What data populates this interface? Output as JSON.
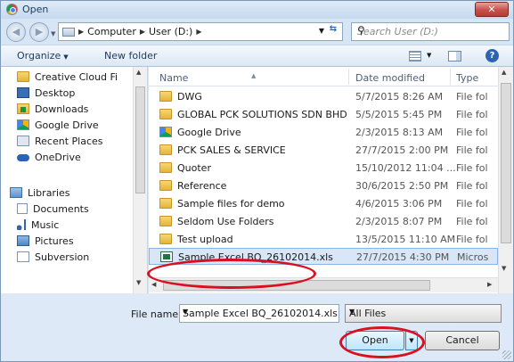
{
  "window": {
    "title": "Open",
    "close_glyph": "✕"
  },
  "nav": {
    "back_glyph": "◀",
    "forward_glyph": "▶",
    "breadcrumbs": [
      "Computer",
      "User (D:)"
    ],
    "search_placeholder": "Search User (D:)"
  },
  "toolbar": {
    "organize": "Organize",
    "new_folder": "New folder",
    "help_glyph": "?"
  },
  "sidebar": {
    "items": [
      {
        "label": "Creative Cloud Fi",
        "icon": "folder-icon"
      },
      {
        "label": "Desktop",
        "icon": "desktop-icon"
      },
      {
        "label": "Downloads",
        "icon": "downloads-icon"
      },
      {
        "label": "Google Drive",
        "icon": "google-drive-icon"
      },
      {
        "label": "Recent Places",
        "icon": "recent-places-icon"
      },
      {
        "label": "OneDrive",
        "icon": "onedrive-icon"
      },
      {
        "label": "Libraries",
        "icon": "libraries-icon"
      },
      {
        "label": "Documents",
        "icon": "documents-icon"
      },
      {
        "label": "Music",
        "icon": "music-icon"
      },
      {
        "label": "Pictures",
        "icon": "pictures-icon"
      },
      {
        "label": "Subversion",
        "icon": "subversion-icon"
      }
    ]
  },
  "files": {
    "columns": {
      "name": "Name",
      "date": "Date modified",
      "type": "Type"
    },
    "rows": [
      {
        "name": "DWG",
        "date": "5/7/2015 8:26 AM",
        "type": "File fol",
        "icon": "folder-icon"
      },
      {
        "name": "GLOBAL PCK SOLUTIONS SDN BHD",
        "date": "5/5/2015 5:45 PM",
        "type": "File fol",
        "icon": "folder-icon"
      },
      {
        "name": "Google Drive",
        "date": "2/3/2015 8:13 AM",
        "type": "File fol",
        "icon": "google-drive-folder-icon"
      },
      {
        "name": "PCK SALES & SERVICE",
        "date": "27/7/2015 2:00 PM",
        "type": "File fol",
        "icon": "folder-icon"
      },
      {
        "name": "Quoter",
        "date": "15/10/2012 11:04 ...",
        "type": "File fol",
        "icon": "folder-icon"
      },
      {
        "name": "Reference",
        "date": "30/6/2015 2:50 PM",
        "type": "File fol",
        "icon": "folder-icon"
      },
      {
        "name": "Sample files for demo",
        "date": "4/6/2015 3:06 PM",
        "type": "File fol",
        "icon": "folder-icon"
      },
      {
        "name": "Seldom Use Folders",
        "date": "2/3/2015 8:07 PM",
        "type": "File fol",
        "icon": "folder-icon"
      },
      {
        "name": "Test upload",
        "date": "13/5/2015 11:10 AM",
        "type": "File fol",
        "icon": "folder-icon"
      },
      {
        "name": "Sample Excel BQ_26102014.xls",
        "date": "27/7/2015 4:30 PM",
        "type": "Micros",
        "icon": "excel-file-icon",
        "selected": true
      }
    ]
  },
  "bottom": {
    "file_name_label": "File name:",
    "file_name_value": "Sample Excel BQ_26102014.xls",
    "file_type_value": "All Files",
    "open_label": "Open",
    "cancel_label": "Cancel"
  },
  "colors": {
    "annotation": "#d8101f",
    "selection": "#d8e6f7",
    "window_frame": "#d7e6f5"
  }
}
